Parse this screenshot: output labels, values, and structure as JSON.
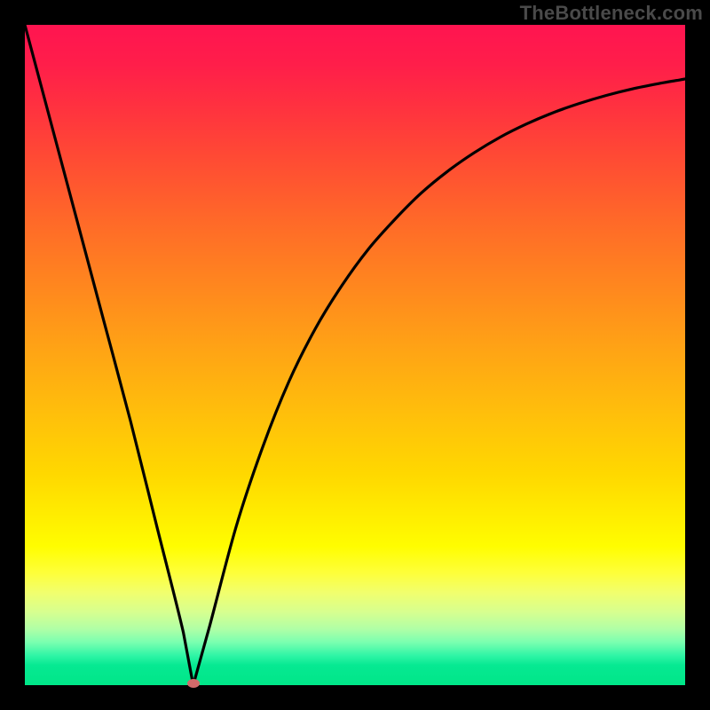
{
  "watermark": {
    "text": "TheBottleneck.com"
  },
  "chart_data": {
    "type": "line",
    "title": "",
    "xlabel": "",
    "ylabel": "",
    "xlim": [
      0,
      100
    ],
    "ylim": [
      0,
      100
    ],
    "grid": false,
    "legend": false,
    "series": [
      {
        "name": "bottleneck-curve",
        "x": [
          0,
          4,
          8,
          12,
          16,
          20,
          24,
          25.5,
          28,
          32,
          36,
          40,
          44,
          48,
          52,
          56,
          60,
          64,
          68,
          72,
          76,
          80,
          84,
          88,
          92,
          96,
          100
        ],
        "values": [
          100,
          85,
          70,
          55,
          40,
          24,
          8,
          0,
          9,
          24,
          36,
          46,
          54,
          60.5,
          66,
          70.5,
          74.5,
          77.8,
          80.6,
          83,
          85,
          86.7,
          88.1,
          89.3,
          90.3,
          91.1,
          91.8
        ]
      }
    ],
    "vertex": {
      "x": 25.5,
      "y": 0
    },
    "background_gradient": {
      "type": "vertical",
      "stops": [
        {
          "pos": 0.0,
          "color": "#ff1450"
        },
        {
          "pos": 0.5,
          "color": "#ffa614"
        },
        {
          "pos": 0.8,
          "color": "#fffd00"
        },
        {
          "pos": 1.0,
          "color": "#00e688"
        }
      ]
    },
    "annotations": [
      {
        "type": "marker",
        "shape": "ellipse",
        "x": 25.5,
        "y": 0,
        "color": "#d16a6a"
      }
    ]
  }
}
